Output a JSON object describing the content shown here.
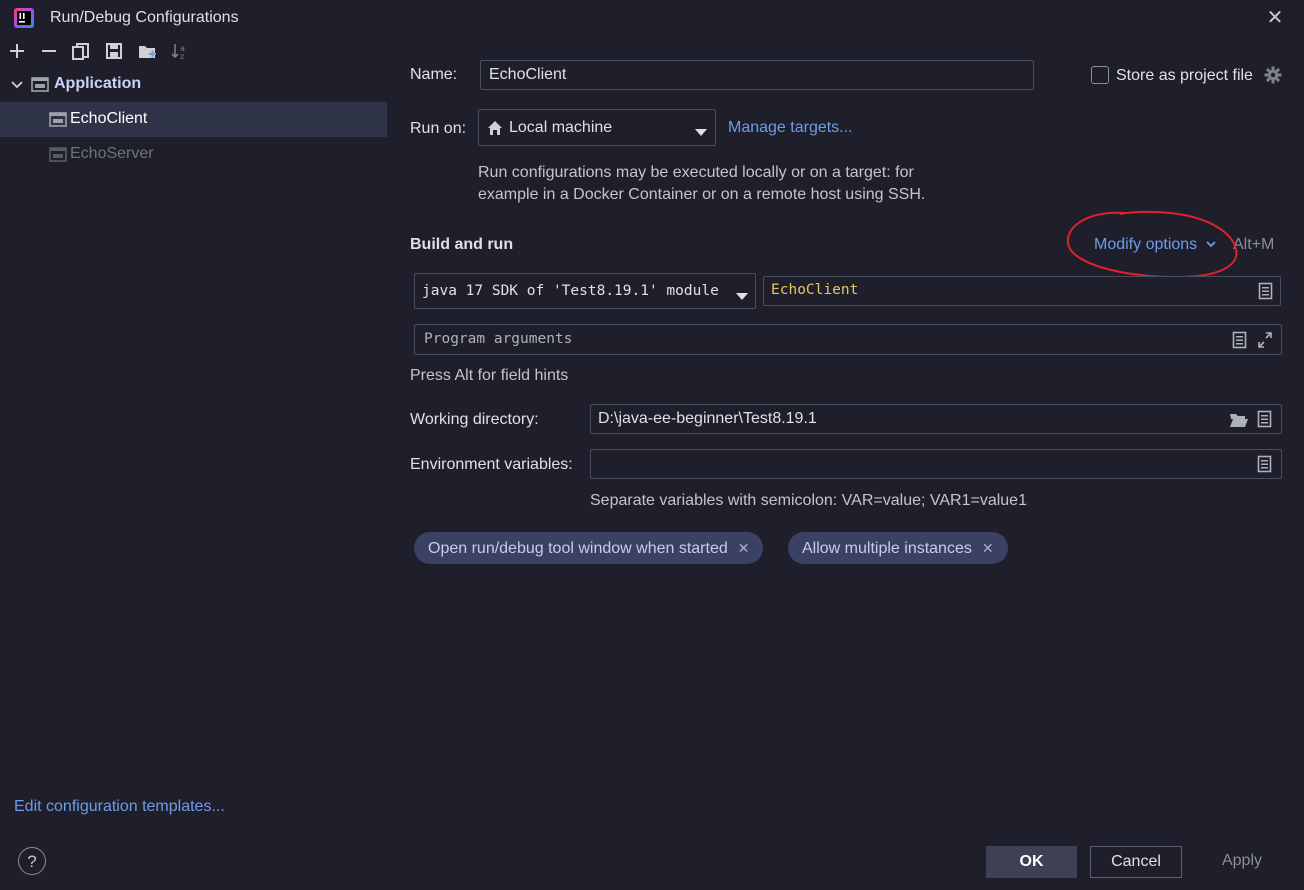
{
  "window": {
    "title": "Run/Debug Configurations"
  },
  "tree": {
    "group_label": "Application",
    "items": [
      {
        "label": "EchoClient",
        "selected": true
      },
      {
        "label": "EchoServer",
        "selected": false
      }
    ]
  },
  "footer_left": {
    "edit_templates": "Edit configuration templates...",
    "help": "?"
  },
  "form": {
    "name_label": "Name:",
    "name_value": "EchoClient",
    "store_label": "Store as project file",
    "run_on_label": "Run on:",
    "run_on_value": "Local machine",
    "manage_targets": "Manage targets...",
    "run_hint_line1": "Run configurations may be executed locally or on a target: for",
    "run_hint_line2": "example in a Docker Container or on a remote host using SSH.",
    "build_run_heading": "Build and run",
    "modify_options": "Modify options",
    "modify_shortcut": "Alt+M",
    "sdk_value": "java 17 SDK of 'Test8.19.1' module",
    "main_class_value": "EchoClient",
    "program_args_placeholder": "Program arguments",
    "field_hint": "Press Alt for field hints",
    "working_dir_label": "Working directory:",
    "working_dir_value": "D:\\java-ee-beginner\\Test8.19.1",
    "env_label": "Environment variables:",
    "env_value": "",
    "env_hint": "Separate variables with semicolon: VAR=value; VAR1=value1",
    "chips": [
      {
        "label": "Open run/debug tool window when started"
      },
      {
        "label": "Allow multiple instances"
      }
    ]
  },
  "buttons": {
    "ok": "OK",
    "cancel": "Cancel",
    "apply": "Apply"
  },
  "colors": {
    "background": "#1e1f2b",
    "selection": "#2f3347",
    "link": "#6e9ce8",
    "chip_bg": "#3b4163",
    "annotation_red": "#e0202a",
    "main_class_text": "#e8c46a"
  },
  "icons": {
    "toolbar": [
      "add-icon",
      "remove-icon",
      "copy-icon",
      "save-icon",
      "new-folder-icon",
      "sort-icon"
    ],
    "field": [
      "document-icon",
      "expand-icon",
      "folder-open-icon",
      "home-icon",
      "gear-icon"
    ]
  }
}
